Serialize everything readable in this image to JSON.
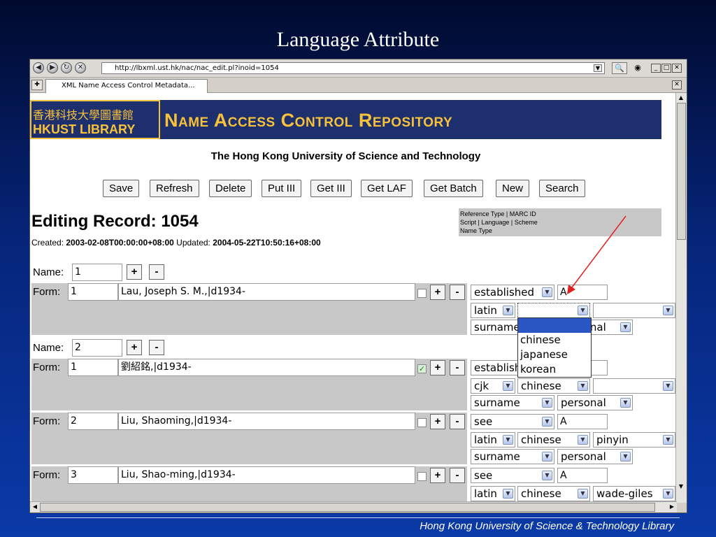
{
  "slide": {
    "title": "Language Attribute",
    "footer": "Hong Kong University of Science & Technology Library"
  },
  "browser": {
    "url": "http://lbxml.ust.hk/nac/nac_edit.pl?inoid=1054",
    "tab_title": "XML Name Access Control Metadata..."
  },
  "page": {
    "logo_cn": "香港科技大學圖書館",
    "logo_en": "HKUST LIBRARY",
    "repo_title": "Name Access Control Repository",
    "university": "The Hong Kong University of Science and Technology",
    "buttons": [
      "Save",
      "Refresh",
      "Delete",
      "Put III",
      "Get III",
      "Get LAF",
      "Get Batch",
      "New",
      "Search"
    ],
    "editing_title": "Editing Record: 1054",
    "created_label": "Created:",
    "created_value": "2003-02-08T00:00:00+08:00",
    "updated_label": "Updated:",
    "updated_value": "2004-05-22T10:50:16+08:00",
    "legend": [
      "Reference Type | MARC ID",
      "Script | Language | Scheme",
      "Name Type"
    ]
  },
  "form": {
    "name_label": "Name:",
    "form_label": "Form:",
    "plus": "+",
    "minus": "-",
    "names": [
      {
        "value": "1",
        "forms": [
          {
            "num": "1",
            "heading": "Lau, Joseph S. M.,|d1934-",
            "checked": false,
            "ref_type": "established",
            "marc_id": "A",
            "script": "latin",
            "language": "",
            "scheme": "",
            "name_type": "surname",
            "category": "personal"
          }
        ]
      },
      {
        "value": "2",
        "forms": [
          {
            "num": "1",
            "heading": "劉紹銘,|d1934-",
            "checked": true,
            "ref_type": "established",
            "marc_id": "",
            "script": "cjk",
            "language": "chinese",
            "scheme": "",
            "name_type": "surname",
            "category": "personal"
          },
          {
            "num": "2",
            "heading": "Liu, Shaoming,|d1934-",
            "checked": false,
            "ref_type": "see",
            "marc_id": "A",
            "script": "latin",
            "language": "chinese",
            "scheme": "pinyin",
            "name_type": "surname",
            "category": "personal"
          },
          {
            "num": "3",
            "heading": "Liu, Shao-ming,|d1934-",
            "checked": false,
            "ref_type": "see",
            "marc_id": "A",
            "script": "latin",
            "language": "chinese",
            "scheme": "wade-giles",
            "name_type": "",
            "category": ""
          }
        ]
      }
    ],
    "language_dropdown_options": [
      "",
      "chinese",
      "japanese",
      "korean"
    ]
  },
  "colors": {
    "banner_bg": "#1e2f6e",
    "banner_text": "#f7c23a",
    "row_gray": "#c8c8c8",
    "highlight": "#2a57c4",
    "arrow": "#e02020"
  }
}
